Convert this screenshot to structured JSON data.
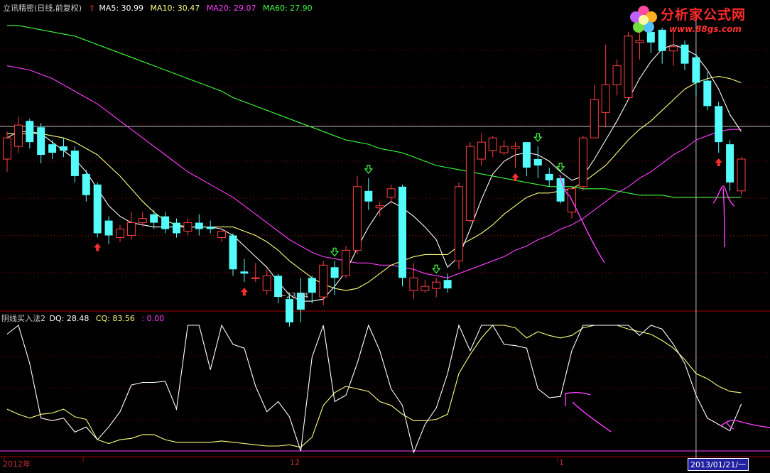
{
  "header": {
    "title": "立讯精密(日线,前复权)",
    "ma5": "MA5: 30.99",
    "ma10": "MA10: 30.47",
    "ma20": "MA20: 29.07",
    "ma60": "MA60: 27.90"
  },
  "sub": {
    "title": "阴线买入法2",
    "dq": "DQ: 28.48",
    "cq": "CQ: 83.56",
    "third": ": 0.00"
  },
  "logo": {
    "cn": "分析家公式网",
    "url": "www.88gs.com"
  },
  "x_labels": {
    "year": "2012年",
    "dec": "12",
    "jan": "1",
    "cursor_date": "2013/01/21/一"
  },
  "low_label": "23.34",
  "colors": {
    "up": "#ff4040",
    "down": "#54fcfc",
    "ma5": "#ffffff",
    "ma10": "#ffff80",
    "ma20": "#ff40ff",
    "ma60": "#40ff40",
    "buy": "#ff3030",
    "sell": "#40ff40"
  },
  "chart_data": [
    {
      "type": "candlestick",
      "series_labels": [
        "MA5",
        "MA10",
        "MA20",
        "MA60"
      ],
      "ylim": [
        22.5,
        36.5
      ],
      "candles": [
        [
          29.6,
          30.6,
          29.0,
          30.9
        ],
        [
          30.2,
          31.2,
          29.9,
          31.6
        ],
        [
          31.4,
          30.4,
          30.1,
          31.5
        ],
        [
          31.1,
          29.8,
          29.4,
          31.3
        ],
        [
          30.3,
          29.9,
          29.6,
          30.5
        ],
        [
          30.2,
          30.0,
          29.7,
          30.6
        ],
        [
          30.0,
          28.8,
          28.5,
          30.2
        ],
        [
          28.9,
          27.9,
          27.6,
          29.1
        ],
        [
          28.4,
          26.1,
          25.9,
          28.5
        ],
        [
          26.7,
          26.0,
          25.6,
          26.9
        ],
        [
          25.9,
          26.3,
          25.7,
          26.5
        ],
        [
          26.0,
          26.6,
          25.8,
          27.1
        ],
        [
          26.6,
          26.8,
          26.4,
          27.1
        ],
        [
          27.0,
          26.6,
          26.3,
          27.2
        ],
        [
          26.9,
          26.3,
          26.1,
          27.1
        ],
        [
          26.6,
          26.1,
          25.9,
          26.8
        ],
        [
          26.2,
          26.6,
          26.0,
          26.8
        ],
        [
          26.6,
          26.3,
          26.0,
          27.0
        ],
        [
          26.4,
          26.3,
          26.1,
          26.7
        ],
        [
          25.9,
          26.2,
          25.7,
          26.3
        ],
        [
          26.0,
          24.4,
          24.1,
          26.1
        ],
        [
          24.3,
          24.2,
          23.8,
          24.9
        ],
        [
          24.0,
          24.0,
          23.8,
          24.7
        ],
        [
          23.4,
          24.1,
          23.2,
          24.4
        ],
        [
          24.1,
          23.1,
          22.8,
          24.2
        ],
        [
          23.0,
          21.9,
          21.7,
          23.3
        ],
        [
          23.3,
          22.5,
          21.9,
          24.0
        ],
        [
          24.0,
          23.3,
          22.8,
          24.1
        ],
        [
          23.1,
          24.6,
          22.7,
          24.8
        ],
        [
          24.5,
          24.0,
          23.2,
          24.8
        ],
        [
          24.1,
          25.3,
          24.0,
          25.5
        ],
        [
          25.3,
          28.3,
          25.1,
          28.8
        ],
        [
          28.1,
          27.6,
          27.2,
          28.7
        ],
        [
          27.3,
          27.4,
          26.9,
          27.6
        ],
        [
          27.8,
          28.2,
          27.5,
          28.4
        ],
        [
          28.3,
          24.0,
          23.6,
          28.4
        ],
        [
          23.4,
          24.0,
          23.0,
          24.7
        ],
        [
          23.4,
          23.6,
          23.3,
          23.9
        ],
        [
          23.5,
          23.8,
          23.1,
          24.0
        ],
        [
          23.9,
          23.5,
          23.3,
          24.2
        ],
        [
          24.8,
          28.3,
          24.4,
          28.5
        ],
        [
          26.7,
          30.2,
          26.6,
          30.4
        ],
        [
          29.6,
          30.4,
          29.3,
          30.8
        ],
        [
          30.0,
          30.6,
          29.7,
          30.7
        ],
        [
          29.9,
          30.2,
          29.8,
          30.5
        ],
        [
          30.1,
          30.2,
          29.2,
          30.4
        ],
        [
          30.4,
          29.2,
          28.8,
          30.4
        ],
        [
          29.6,
          29.3,
          28.7,
          30.2
        ],
        [
          28.9,
          28.6,
          28.3,
          29.2
        ],
        [
          28.7,
          27.6,
          27.5,
          28.8
        ],
        [
          27.1,
          28.2,
          26.8,
          28.3
        ],
        [
          28.3,
          30.6,
          28.1,
          30.7
        ],
        [
          30.6,
          32.4,
          30.6,
          33.1
        ],
        [
          31.8,
          33.1,
          31.1,
          35.0
        ],
        [
          33.1,
          34.0,
          32.6,
          34.3
        ],
        [
          32.5,
          35.4,
          32.4,
          35.6
        ],
        [
          35.1,
          35.2,
          34.3,
          36.0
        ],
        [
          35.6,
          35.1,
          34.6,
          35.8
        ],
        [
          35.7,
          34.7,
          34.1,
          35.8
        ],
        [
          34.7,
          34.9,
          34.0,
          35.6
        ],
        [
          35.0,
          34.1,
          33.8,
          35.2
        ],
        [
          34.4,
          33.2,
          32.6,
          34.6
        ],
        [
          33.3,
          32.1,
          31.9,
          33.7
        ],
        [
          32.1,
          30.4,
          29.9,
          32.3
        ],
        [
          30.3,
          28.5,
          28.1,
          30.5
        ],
        [
          28.1,
          29.6,
          27.9,
          29.7
        ]
      ],
      "ma5": [
        30.6,
        30.9,
        30.9,
        30.8,
        30.4,
        30.0,
        29.6,
        29.0,
        28.2,
        27.4,
        26.9,
        26.6,
        26.5,
        26.4,
        26.4,
        26.4,
        26.4,
        26.4,
        26.4,
        26.3,
        26.0,
        25.5,
        25.0,
        24.5,
        23.8,
        23.2,
        22.9,
        22.9,
        23.0,
        23.6,
        24.3,
        25.4,
        26.4,
        27.2,
        27.6,
        27.3,
        26.9,
        26.4,
        25.8,
        24.5,
        25.0,
        26.3,
        27.7,
        28.9,
        29.5,
        29.8,
        29.9,
        29.8,
        29.5,
        29.0,
        28.6,
        28.8,
        29.6,
        30.5,
        31.4,
        32.4,
        33.4,
        34.2,
        34.8,
        35.0,
        34.8,
        34.5,
        33.8,
        32.9,
        31.7,
        30.9
      ],
      "ma10": [
        30.8,
        30.8,
        30.8,
        30.8,
        30.7,
        30.6,
        30.4,
        30.1,
        29.8,
        29.3,
        28.8,
        28.2,
        27.6,
        27.1,
        26.7,
        26.5,
        26.4,
        26.4,
        26.4,
        26.4,
        26.4,
        26.2,
        26.0,
        25.7,
        25.3,
        24.8,
        24.4,
        24.0,
        23.7,
        23.5,
        23.4,
        23.5,
        23.8,
        24.2,
        24.6,
        24.8,
        25.0,
        25.1,
        25.1,
        25.1,
        25.5,
        25.8,
        26.1,
        26.5,
        27.0,
        27.4,
        27.8,
        28.0,
        28.0,
        28.1,
        28.2,
        28.5,
        28.9,
        29.3,
        29.9,
        30.5,
        31.0,
        31.4,
        31.9,
        32.4,
        32.9,
        33.2,
        33.4,
        33.5,
        33.4,
        33.2
      ],
      "ma20": [
        34.0,
        33.9,
        33.8,
        33.6,
        33.4,
        33.1,
        32.8,
        32.5,
        32.2,
        31.8,
        31.4,
        31.0,
        30.6,
        30.2,
        29.8,
        29.4,
        29.0,
        28.7,
        28.4,
        28.1,
        27.8,
        27.4,
        27.0,
        26.6,
        26.2,
        25.8,
        25.5,
        25.2,
        25.0,
        24.9,
        24.8,
        24.7,
        24.7,
        24.6,
        24.6,
        24.5,
        24.4,
        24.2,
        24.1,
        24.0,
        24.2,
        24.4,
        24.6,
        24.8,
        25.0,
        25.3,
        25.5,
        25.8,
        26.0,
        26.3,
        26.5,
        26.8,
        27.2,
        27.6,
        28.0,
        28.3,
        28.7,
        29.0,
        29.4,
        29.8,
        30.1,
        30.5,
        30.7,
        30.9,
        31.0,
        31.0
      ],
      "ma60": [
        35.9,
        35.9,
        35.8,
        35.7,
        35.6,
        35.5,
        35.4,
        35.2,
        35.0,
        34.8,
        34.6,
        34.4,
        34.2,
        34.0,
        33.8,
        33.6,
        33.4,
        33.2,
        33.0,
        32.8,
        32.5,
        32.3,
        32.1,
        31.9,
        31.7,
        31.5,
        31.3,
        31.1,
        30.9,
        30.7,
        30.5,
        30.4,
        30.3,
        30.1,
        30.0,
        29.9,
        29.7,
        29.5,
        29.3,
        29.2,
        29.1,
        29.0,
        28.9,
        28.8,
        28.7,
        28.6,
        28.5,
        28.4,
        28.3,
        28.3,
        28.3,
        28.2,
        28.2,
        28.2,
        28.1,
        28.0,
        27.9,
        27.9,
        27.9,
        27.8,
        27.8,
        27.8,
        27.8,
        27.8,
        27.8,
        27.8
      ],
      "buy_signals": [
        8,
        21,
        45,
        63
      ],
      "sell_signals": [
        29,
        32,
        38,
        47,
        49
      ],
      "low": {
        "index": 24,
        "value": 23.34
      }
    },
    {
      "type": "line",
      "series_labels": [
        "DQ",
        "CQ"
      ],
      "ylim": [
        0,
        100
      ],
      "dq": [
        93,
        100,
        70,
        27,
        25,
        27,
        16,
        20,
        10,
        20,
        32,
        53,
        55,
        55,
        56,
        34,
        100,
        100,
        65,
        100,
        85,
        82,
        52,
        32,
        40,
        28,
        1,
        75,
        100,
        40,
        45,
        70,
        100,
        80,
        50,
        37,
        0,
        22,
        35,
        62,
        100,
        80,
        100,
        100,
        85,
        84,
        82,
        50,
        43,
        44,
        80,
        100,
        100,
        100,
        100,
        100,
        92,
        100,
        97,
        85,
        70,
        45,
        27,
        22,
        17,
        38
      ],
      "cq": [
        34,
        30,
        27,
        30,
        31,
        34,
        28,
        26,
        10,
        7,
        10,
        11,
        14,
        14,
        10,
        8,
        8,
        8,
        8,
        9,
        8,
        7,
        6,
        5,
        5,
        6,
        4,
        12,
        37,
        47,
        52,
        50,
        48,
        40,
        37,
        30,
        25,
        25,
        26,
        30,
        62,
        77,
        90,
        100,
        100,
        98,
        90,
        95,
        92,
        90,
        92,
        98,
        100,
        100,
        100,
        97,
        95,
        93,
        88,
        82,
        73,
        62,
        58,
        52,
        48,
        47
      ]
    }
  ]
}
